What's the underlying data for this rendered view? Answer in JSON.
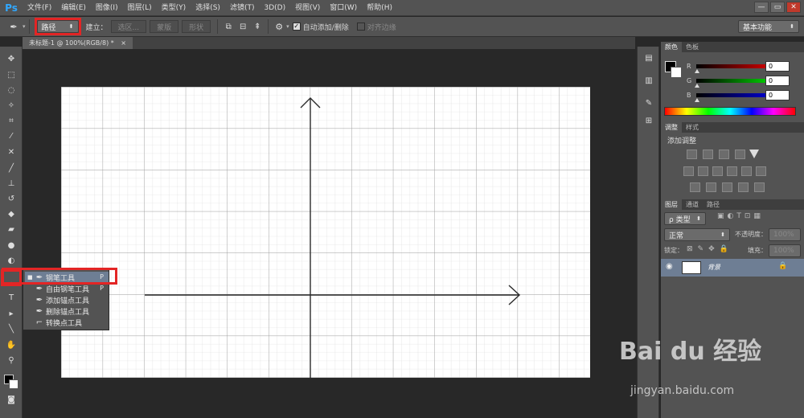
{
  "app": {
    "logo": "Ps"
  },
  "menu": [
    "文件(F)",
    "编辑(E)",
    "图像(I)",
    "图层(L)",
    "类型(Y)",
    "选择(S)",
    "滤镜(T)",
    "3D(D)",
    "视图(V)",
    "窗口(W)",
    "帮助(H)"
  ],
  "window_controls": {
    "minimize": "—",
    "restore": "▭",
    "close": "✕"
  },
  "options_bar": {
    "mode": "路径",
    "build_label": "建立：",
    "selection_btn": "选区...",
    "mask_btn": "蒙版",
    "shape_btn": "形状",
    "auto_add_delete": "自动添加/删除",
    "auto_add_delete_checked": true,
    "align_edges": "对齐边缘",
    "align_edges_checked": false,
    "workspace": "基本功能"
  },
  "document": {
    "tab_title": "未标题-1 @ 100%(RGB/8) *",
    "close": "×"
  },
  "tools": [
    "move-tool",
    "marquee-tool",
    "lasso-tool",
    "quick-select-tool",
    "crop-tool",
    "eyedropper-tool",
    "healing-tool",
    "brush-tool",
    "stamp-tool",
    "history-brush-tool",
    "eraser-tool",
    "gradient-tool",
    "blur-tool",
    "dodge-tool",
    "pen-tool",
    "type-tool",
    "path-select-tool",
    "line-tool",
    "hand-tool",
    "zoom-tool"
  ],
  "flyout": {
    "items": [
      {
        "label": "钢笔工具",
        "key": "P",
        "selected": true
      },
      {
        "label": "自由钢笔工具",
        "key": "P",
        "selected": false
      },
      {
        "label": "添加锚点工具",
        "key": "",
        "selected": false
      },
      {
        "label": "删除锚点工具",
        "key": "",
        "selected": false
      },
      {
        "label": "转换点工具",
        "key": "",
        "selected": false
      }
    ]
  },
  "color_panel": {
    "tabs": [
      "颜色",
      "色板"
    ],
    "channels": [
      {
        "label": "R",
        "value": "0"
      },
      {
        "label": "G",
        "value": "0"
      },
      {
        "label": "B",
        "value": "0"
      }
    ]
  },
  "adjust_panel": {
    "tabs": [
      "调整",
      "样式"
    ],
    "heading": "添加调整"
  },
  "layers_panel": {
    "tabs": [
      "图层",
      "通道",
      "路径"
    ],
    "filter_label": "ρ 类型",
    "blend_mode": "正常",
    "opacity_label": "不透明度：",
    "opacity_value": "100%",
    "lock_label": "锁定：",
    "fill_label": "填充：",
    "fill_value": "100%",
    "layers": [
      {
        "name": "背景",
        "visible": true,
        "locked": true
      }
    ]
  },
  "watermark": {
    "logo": "Bai du 经验",
    "url": "jingyan.baidu.com"
  },
  "colors": {
    "accent_red": "#e32525",
    "panel_bg": "#535353",
    "canvas_bg": "#282828",
    "selection_blue": "#6e7e94"
  }
}
